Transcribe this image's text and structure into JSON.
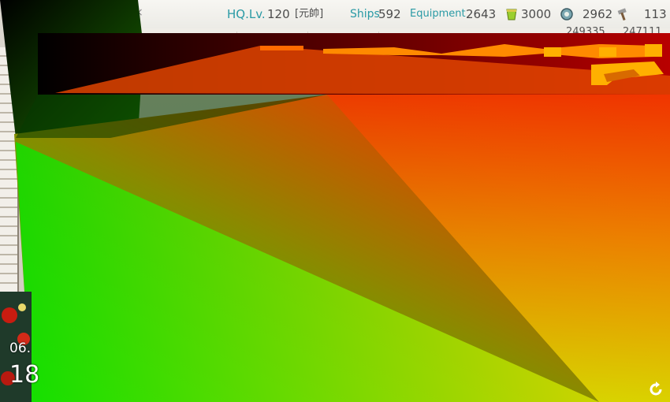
{
  "hud": {
    "hq_label": "HQ.Lv.",
    "hq_level": "120",
    "rank": "[元帥]",
    "ships_label": "Ships",
    "ships_count": "592",
    "equipment_label": "Equipment",
    "equipment_count": "2643",
    "fuel_value": "3000",
    "steel_value": "2962",
    "build_value": "113"
  },
  "resources_row": {
    "value_1": "249335",
    "value_2": "247111"
  },
  "clock": {
    "date": "06.",
    "time": "18"
  },
  "icons": {
    "close": "close-icon",
    "bucket": "bucket-icon",
    "gear": "gear-icon",
    "hammer": "hammer-icon",
    "refresh": "refresh-icon"
  },
  "colors": {
    "hud_accent": "#2a9aa5",
    "hud_text": "#4c4c4c",
    "glitch_red": "#e83a00",
    "glitch_green": "#10e000",
    "glitch_yellow": "#e6e000"
  }
}
